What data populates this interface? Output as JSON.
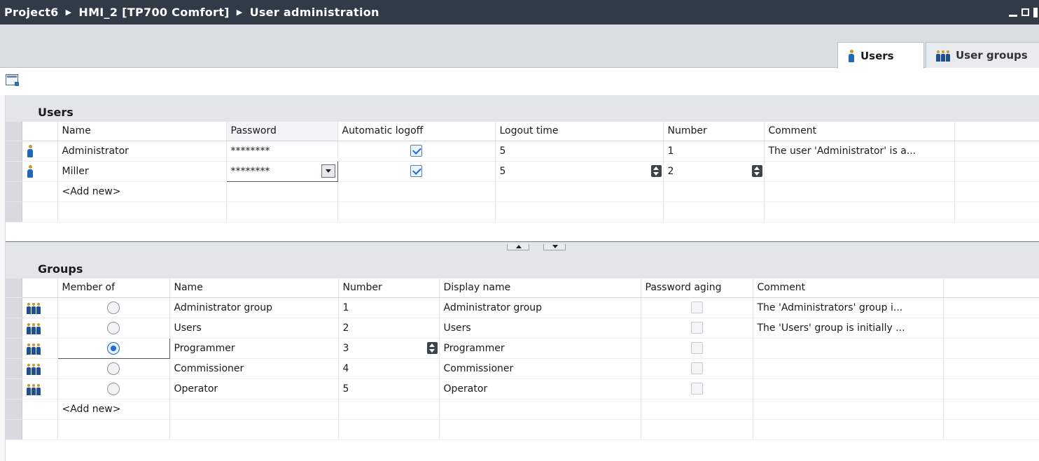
{
  "title": {
    "project": "Project6",
    "device": "HMI_2 [TP700 Comfort]",
    "editor": "User administration",
    "separator": "▶"
  },
  "tabs": [
    {
      "label": "Users",
      "icon": "user-icon",
      "active": true
    },
    {
      "label": "User groups",
      "icon": "group-icon",
      "active": false
    }
  ],
  "users": {
    "heading": "Users",
    "columns": [
      "Name",
      "Password",
      "Automatic logoff",
      "Logout time",
      "Number",
      "Comment"
    ],
    "rows": [
      {
        "name": "Administrator",
        "password": "********",
        "auto_logoff": true,
        "logout_time": "5",
        "number": "1",
        "comment": "The user 'Administrator' is a..."
      },
      {
        "name": "Miller",
        "password": "********",
        "auto_logoff": true,
        "logout_time": "5",
        "number": "2",
        "comment": ""
      }
    ],
    "add_new": "<Add new>"
  },
  "groups": {
    "heading": "Groups",
    "columns": [
      "Member of",
      "Name",
      "Number",
      "Display name",
      "Password aging",
      "Comment"
    ],
    "rows": [
      {
        "member": false,
        "name": "Administrator group",
        "number": "1",
        "display_name": "Administrator group",
        "password_aging": false,
        "comment": "The 'Administrators' group i..."
      },
      {
        "member": false,
        "name": "Users",
        "number": "2",
        "display_name": "Users",
        "password_aging": false,
        "comment": "The 'Users' group is initially ..."
      },
      {
        "member": true,
        "name": "Programmer",
        "number": "3",
        "display_name": "Programmer",
        "password_aging": false,
        "comment": ""
      },
      {
        "member": false,
        "name": "Commissioner",
        "number": "4",
        "display_name": "Commissioner",
        "password_aging": false,
        "comment": ""
      },
      {
        "member": false,
        "name": "Operator",
        "number": "5",
        "display_name": "Operator",
        "password_aging": false,
        "comment": ""
      }
    ],
    "add_new": "<Add new>"
  }
}
